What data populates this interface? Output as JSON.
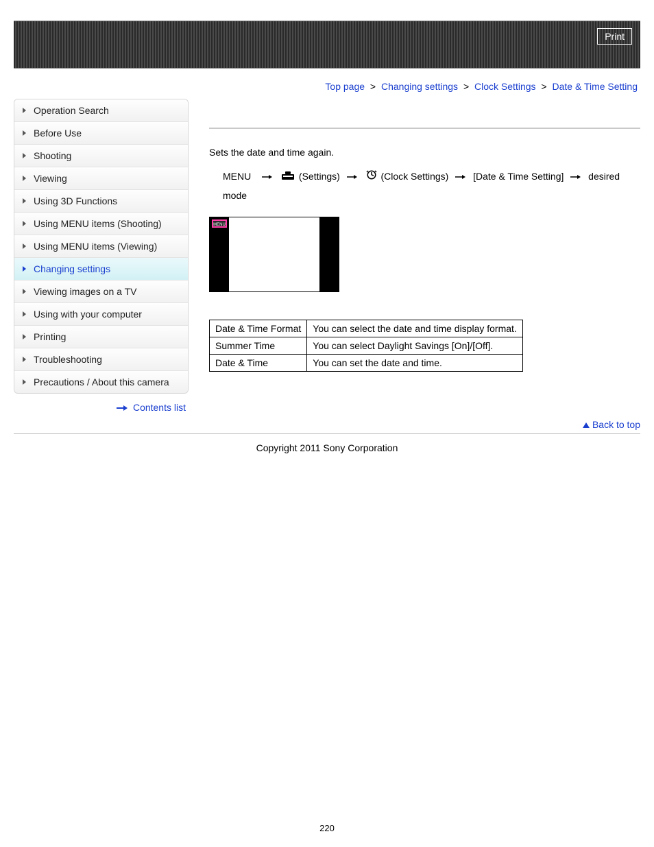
{
  "header": {
    "print_label": "Print"
  },
  "breadcrumb": {
    "items": [
      "Top page",
      "Changing settings",
      "Clock Settings",
      "Date & Time Setting"
    ],
    "separator": ">"
  },
  "sidebar": {
    "items": [
      {
        "label": "Operation Search",
        "active": false
      },
      {
        "label": "Before Use",
        "active": false
      },
      {
        "label": "Shooting",
        "active": false
      },
      {
        "label": "Viewing",
        "active": false
      },
      {
        "label": "Using 3D Functions",
        "active": false
      },
      {
        "label": "Using MENU items (Shooting)",
        "active": false
      },
      {
        "label": "Using MENU items (Viewing)",
        "active": false
      },
      {
        "label": "Changing settings",
        "active": true
      },
      {
        "label": "Viewing images on a TV",
        "active": false
      },
      {
        "label": "Using with your computer",
        "active": false
      },
      {
        "label": "Printing",
        "active": false
      },
      {
        "label": "Troubleshooting",
        "active": false
      },
      {
        "label": "Precautions / About this camera",
        "active": false
      }
    ],
    "contents_link": "Contents list"
  },
  "main": {
    "intro": "Sets the date and time again.",
    "menu_path": {
      "start": "MENU",
      "step1": "(Settings)",
      "step2": "(Clock Settings)",
      "step3": "[Date & Time Setting]",
      "end": "desired mode"
    },
    "screenshot_chip": "MENU",
    "table": {
      "rows": [
        {
          "k": "Date & Time Format",
          "v": "You can select the date and time display format."
        },
        {
          "k": "Summer Time",
          "v": "You can select Daylight Savings [On]/[Off]."
        },
        {
          "k": "Date & Time",
          "v": "You can set the date and time."
        }
      ]
    }
  },
  "footer": {
    "back_to_top": "Back to top",
    "copyright": "Copyright 2011 Sony Corporation",
    "page_number": "220"
  }
}
